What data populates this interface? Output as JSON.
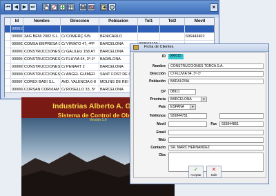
{
  "toolbar": {
    "nav": [
      "⏮",
      "◀",
      "▶",
      "⏭"
    ],
    "tools": [
      "copy-icon",
      "edit-icon",
      "add-icon",
      "grid-icon",
      "print-icon",
      "delete-icon",
      "exit-icon",
      "options-icon"
    ],
    "close": "×"
  },
  "grid": {
    "columns": [
      "Id",
      "Nombre",
      "Direccion",
      "Poblacion",
      "Tel1",
      "Tel2",
      "Movil"
    ],
    "rows": [
      [
        "000015",
        "",
        "",
        "",
        "",
        "",
        ""
      ],
      [
        "000001",
        "3AG BENI 2002 S.L.",
        "C/ COMERÇ S/N",
        "BENICARLO",
        "",
        "",
        "696443402"
      ],
      [
        "000002",
        "COMSA EMPRESA C",
        "C/ VIRIATO 47, 4ºP",
        "BARCELONA",
        "933662120",
        "",
        ""
      ],
      [
        "000003",
        "CONSTRUCCIONES",
        "C/ GALILEU 158 AT",
        "BARCELONA",
        "",
        "",
        ""
      ],
      [
        "000004",
        "CONSTRUCCIONES",
        "C/ FLUVIA 64, 3º-1º",
        "BADALONA",
        "",
        "",
        ""
      ],
      [
        "000005",
        "CONSTRUCCIONES",
        "C/ PENART 2",
        "BARCELONA",
        "",
        "",
        ""
      ],
      [
        "000006",
        "CONSTRUCCIONES",
        "C/ ANGEL GUIMER",
        "SANT FOST DE CAM",
        "",
        "",
        ""
      ],
      [
        "000007",
        "COREX BADI S.L.",
        "AVD. VALENCIA 6-8",
        "MOLINS DE REI",
        "",
        "",
        ""
      ],
      [
        "000008",
        "CORSAN CORVIAM",
        "C/ ROSELLO 33, 5º",
        "BARCELONA",
        "",
        "",
        ""
      ]
    ],
    "colors": {
      "selected": "#2e5fb8",
      "header": "#edf1f7"
    }
  },
  "splash": {
    "title": "Industrias Alberto A. Gabe",
    "subtitle": "Sistema de Control de Obras",
    "version": "Versión 1.0"
  },
  "dialog": {
    "title": "Ficha de Clientes",
    "labels": {
      "id": "ID",
      "nombre": "Nombre",
      "direccion": "Dirección",
      "poblacion": "Población",
      "cp": "CP",
      "provincia": "Provincia",
      "pais": "País",
      "telefonos": "Teléfonos",
      "movil": "Movil",
      "fax": "Fax",
      "email": "Email",
      "web": "Web",
      "contacto": "Contacto",
      "obs": "Obs"
    },
    "values": {
      "id": "000015",
      "nombre": "CONSTRUCCIONES TORCA S.A.",
      "direccion": "C/ FLUVIA 64, 3º-1º",
      "poblacion": "BADALONA",
      "cp": "08911",
      "provincia": "BARCELONA",
      "pais": "ESPAÑA",
      "tel1": "933844751",
      "tel2": "",
      "movil": "",
      "fax": "933844851",
      "email": "",
      "web": "",
      "contacto": "SR. MARC HERNANDEZ",
      "obs": ""
    },
    "buttons": {
      "accept": "Aceptar",
      "exit": "Salir",
      "accept_icon": "✓",
      "exit_icon": "✕"
    },
    "colors": {
      "id_highlight": "#37c6cf",
      "accept": "#1f9a2e",
      "exit": "#c8282a"
    }
  }
}
